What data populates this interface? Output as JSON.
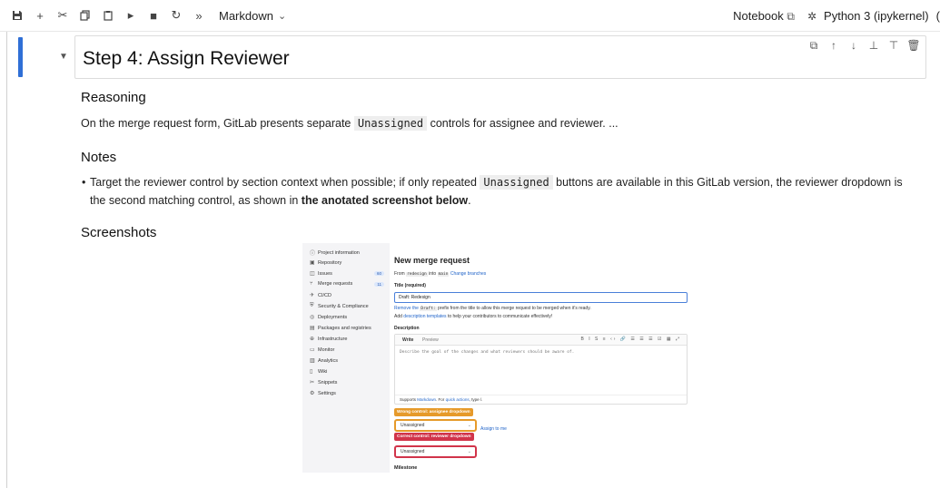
{
  "toolbar": {
    "cell_type": "Markdown",
    "notebook_label": "Notebook",
    "kernel_label": "Python 3 (ipykernel)",
    "kernel_status": "("
  },
  "cell": {
    "title": "Step 4: Assign Reviewer",
    "reasoning_heading": "Reasoning",
    "reasoning_pre": "On the merge request form, GitLab presents separate",
    "reasoning_code": "Unassigned",
    "reasoning_post": "controls for assignee and reviewer. ...",
    "notes_heading": "Notes",
    "note_pre": "Target the reviewer control by section context when possible; if only repeated",
    "note_code": "Unassigned",
    "note_mid": "buttons are available in this GitLab version, the reviewer dropdown is the second matching control, as shown in",
    "note_bold": "the anotated screenshot below",
    "note_end": ".",
    "screenshots_heading": "Screenshots"
  },
  "screenshot": {
    "sidebar": [
      {
        "label": "Project information",
        "icon": "info-icon"
      },
      {
        "label": "Repository",
        "icon": "repo-icon"
      },
      {
        "label": "Issues",
        "icon": "issues-icon",
        "badge": "60"
      },
      {
        "label": "Merge requests",
        "icon": "merge-icon",
        "badge": "11"
      },
      {
        "label": "CI/CD",
        "icon": "rocket-icon"
      },
      {
        "label": "Security & Compliance",
        "icon": "shield-icon"
      },
      {
        "label": "Deployments",
        "icon": "deploy-icon"
      },
      {
        "label": "Packages and registries",
        "icon": "package-icon"
      },
      {
        "label": "Infrastructure",
        "icon": "infra-icon"
      },
      {
        "label": "Monitor",
        "icon": "monitor-icon"
      },
      {
        "label": "Analytics",
        "icon": "chart-icon"
      },
      {
        "label": "Wiki",
        "icon": "book-icon"
      },
      {
        "label": "Snippets",
        "icon": "scissors-icon"
      },
      {
        "label": "Settings",
        "icon": "gear-icon"
      }
    ],
    "title": "New merge request",
    "from_pre": "From",
    "from_branch": "redesign",
    "into": "into",
    "into_branch": "main",
    "change_branches": "Change branches",
    "title_label": "Title (required)",
    "title_value": "Draft: Redesign",
    "remove_pre": "Remove the",
    "remove_code": "Draft:",
    "remove_post": "prefix from the title to allow this merge request to be merged when it's ready.",
    "add_pre": "Add",
    "add_link": "description templates",
    "add_post": "to help your contributors to communicate effectively!",
    "desc_label": "Description",
    "tab_write": "Write",
    "tab_preview": "Preview",
    "fmt_icons": "B I S ≡ ‹› 🔗 ☰ ☰ ☰ ☑ ▦ ⤢",
    "desc_placeholder": "Describe the goal of the changes and what reviewers should be aware of.",
    "foot_pre": "Supports",
    "foot_md": "Markdown",
    "foot_mid": ". For",
    "foot_qa": "quick actions",
    "foot_post": ", type /.",
    "wrong_tag": "Wrong control: assignee dropdown",
    "correct_tag": "Correct control: reviewer dropdown",
    "assignee_value": "Unassigned",
    "reviewer_value": "Unassigned",
    "assign_to_me": "Assign to me",
    "milestone": "Milestone"
  }
}
